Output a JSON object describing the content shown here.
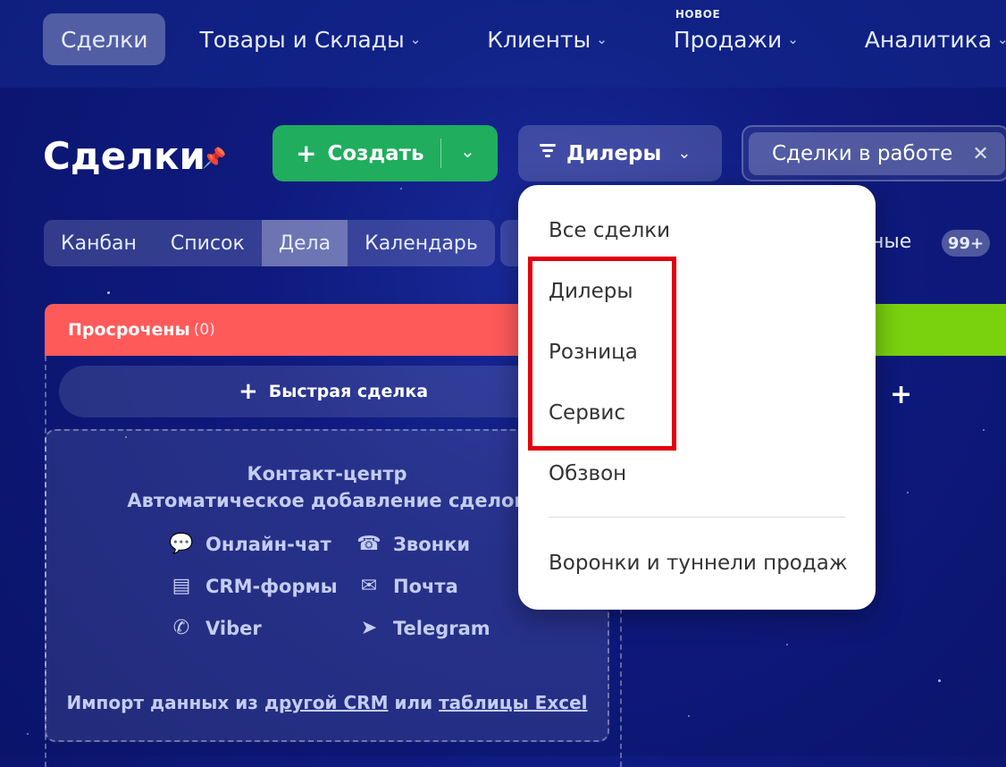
{
  "topnav": {
    "items": [
      {
        "label": "Сделки",
        "active": true,
        "chevron": false
      },
      {
        "label": "Товары и Склады",
        "active": false,
        "chevron": true
      },
      {
        "label": "Клиенты",
        "active": false,
        "chevron": true
      },
      {
        "label": "Продажи",
        "active": false,
        "chevron": true,
        "badge": "НОВОЕ"
      },
      {
        "label": "Аналитика",
        "active": false,
        "chevron": true
      }
    ]
  },
  "header": {
    "title": "Сделки",
    "create_label": "Создать",
    "filter_label": "Дилеры",
    "filter_chip": "Сделки в работе"
  },
  "views": {
    "tabs": [
      {
        "label": "Канбан",
        "active": false
      },
      {
        "label": "Список",
        "active": false
      },
      {
        "label": "Дела",
        "active": true
      },
      {
        "label": "Календарь",
        "active": false
      }
    ],
    "counter_label_partial": "ные",
    "counter_badge": "99+"
  },
  "kanban": {
    "column_title": "Просрочены",
    "column_count": "(0)",
    "quick_deal_label": "Быстрая сделка"
  },
  "contact_center": {
    "title": "Контакт-центр",
    "subtitle": "Автоматическое добавление сделок",
    "channels": [
      {
        "label": "Онлайн-чат",
        "icon": "chat-icon"
      },
      {
        "label": "Звонки",
        "icon": "phone-icon"
      },
      {
        "label": "CRM-формы",
        "icon": "form-icon"
      },
      {
        "label": "Почта",
        "icon": "mail-icon"
      },
      {
        "label": "Viber",
        "icon": "viber-icon"
      },
      {
        "label": "Telegram",
        "icon": "telegram-icon"
      }
    ],
    "import_prefix": "Импорт данных из ",
    "import_link1": "другой CRM",
    "import_mid": " или ",
    "import_link2": "таблицы Excel"
  },
  "dropdown": {
    "items": [
      "Все сделки",
      "Дилеры",
      "Розница",
      "Сервис",
      "Обзвон"
    ],
    "footer_item": "Воронки и туннели продаж"
  },
  "colors": {
    "accent_green": "#20ad5e",
    "overdue_red": "#ff5a5a",
    "highlight_red": "#e3000b",
    "column_green": "#7ad10e"
  }
}
